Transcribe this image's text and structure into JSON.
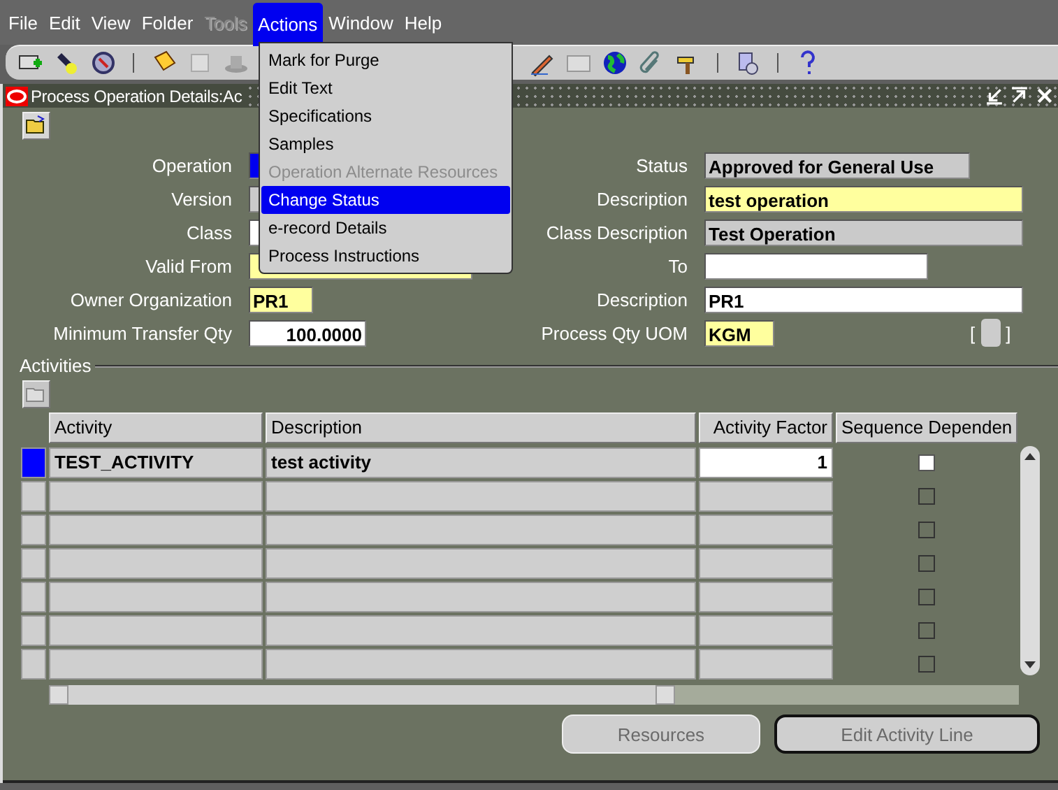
{
  "menu_bar": [
    {
      "label": "File",
      "selected": false,
      "disabled": false
    },
    {
      "label": "Edit",
      "selected": false,
      "disabled": false
    },
    {
      "label": "View",
      "selected": false,
      "disabled": false
    },
    {
      "label": "Folder",
      "selected": false,
      "disabled": false
    },
    {
      "label": "Tools",
      "selected": false,
      "disabled": true
    },
    {
      "label": "Actions",
      "selected": true,
      "disabled": false
    },
    {
      "label": "Window",
      "selected": false,
      "disabled": false
    },
    {
      "label": "Help",
      "selected": false,
      "disabled": false
    }
  ],
  "actions_menu": [
    {
      "label": "Mark for Purge",
      "selected": false,
      "disabled": false
    },
    {
      "label": "Edit Text",
      "selected": false,
      "disabled": false
    },
    {
      "label": "Specifications",
      "selected": false,
      "disabled": false
    },
    {
      "label": "Samples",
      "selected": false,
      "disabled": false
    },
    {
      "label": "Operation Alternate Resources",
      "selected": false,
      "disabled": true
    },
    {
      "label": "Change Status",
      "selected": true,
      "disabled": false
    },
    {
      "label": "e-record Details",
      "selected": false,
      "disabled": false
    },
    {
      "label": "Process Instructions",
      "selected": false,
      "disabled": false
    }
  ],
  "window": {
    "title": "Process Operation Details:Ac"
  },
  "form_rows": [
    {
      "left": {
        "label": "Operation",
        "kind": "normal",
        "highlighted": true
      },
      "right": {
        "label": "Status",
        "value": "Approved for General Use",
        "kind": "readonly"
      }
    },
    {
      "left": {
        "label": "Version",
        "kind": "readonly",
        "highlighted": false
      },
      "right": {
        "label": "Description",
        "value": "test operation",
        "kind": "required"
      }
    },
    {
      "left": {
        "label": "Class",
        "kind": "normal",
        "highlighted": false
      },
      "right": {
        "label": "Class Description",
        "value": "Test Operation",
        "kind": "readonly"
      }
    },
    {
      "left": {
        "label": "Valid From",
        "kind": "required",
        "highlighted": false
      },
      "right": {
        "label": "To",
        "kind": "normal"
      }
    },
    {
      "left": {
        "label": "Owner Organization",
        "value": "PR1",
        "kind": "required",
        "highlighted": false
      },
      "right": {
        "label": "Description",
        "value": "PR1",
        "kind": "normal"
      }
    },
    {
      "left": {
        "label": "Minimum Transfer Qty",
        "value": "100.0000",
        "kind": "normal",
        "highlighted": false
      },
      "right": {
        "label": "Process Qty UOM",
        "value": "KGM",
        "kind": "required"
      }
    }
  ],
  "flexfield_brackets": [
    "[",
    "]"
  ],
  "activities": {
    "title": "Activities",
    "columns": [
      "Activity",
      "Description",
      "Activity Factor",
      "Sequence Dependen"
    ],
    "rows": [
      {
        "current": true,
        "activity": "TEST_ACTIVITY",
        "description": "test activity",
        "factor": "1",
        "checked": false
      },
      {
        "current": false,
        "checked": false
      },
      {
        "current": false,
        "checked": false
      },
      {
        "current": false,
        "checked": false
      },
      {
        "current": false,
        "checked": false
      },
      {
        "current": false,
        "checked": false
      },
      {
        "current": false,
        "checked": false
      }
    ]
  },
  "buttons": [
    {
      "label": "Resources",
      "disabled": true,
      "default": false
    },
    {
      "label": "Edit Activity Line",
      "disabled": true,
      "default": true
    }
  ]
}
